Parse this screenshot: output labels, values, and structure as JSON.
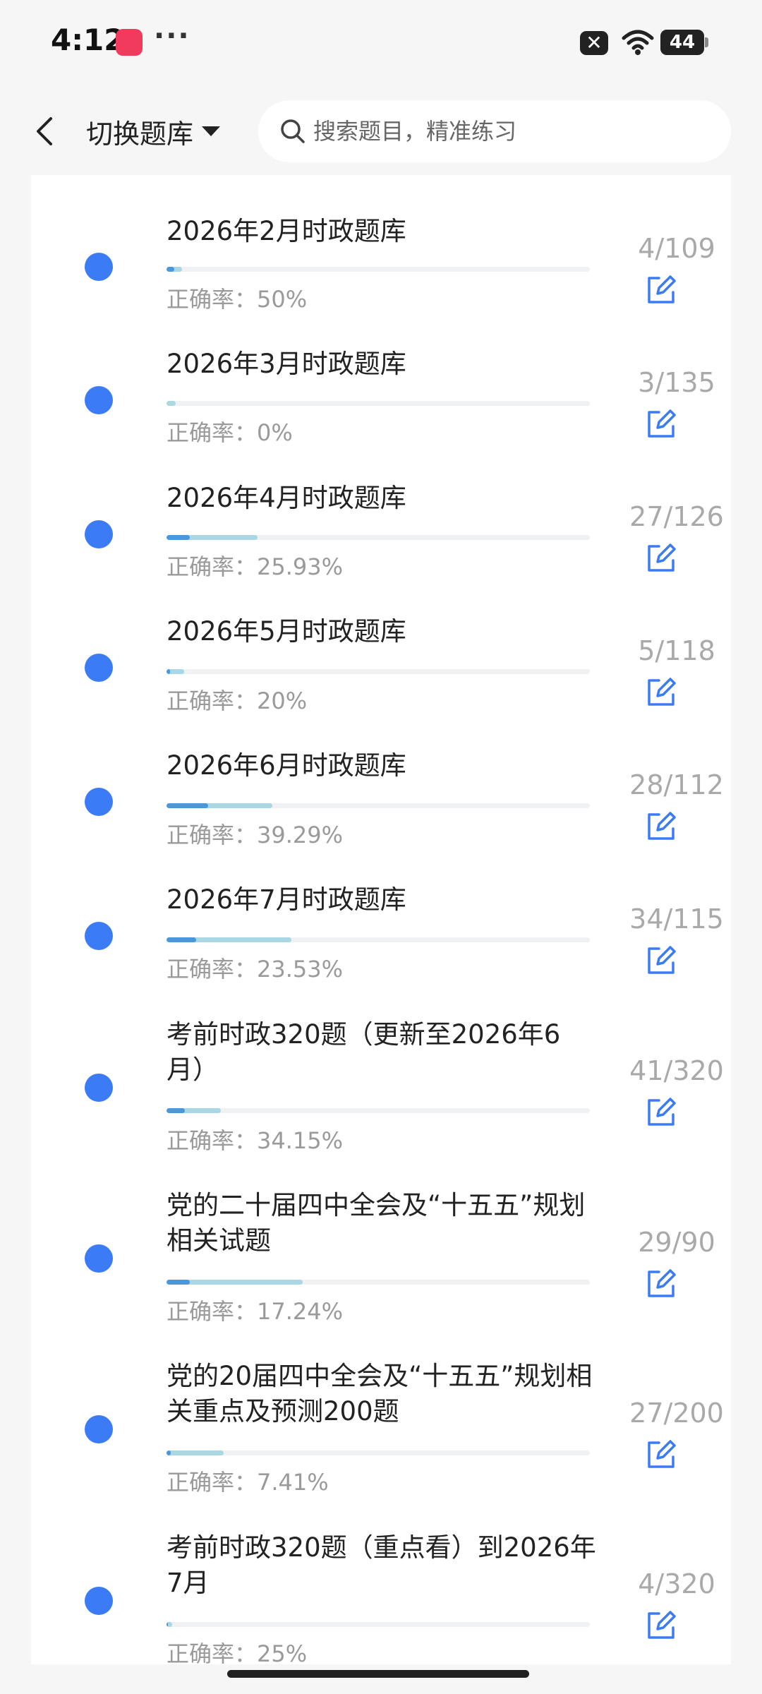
{
  "status_bar": {
    "time": "4:12",
    "more": "···",
    "battery": "44"
  },
  "header": {
    "bank_label": "切换题库",
    "search_placeholder": "搜索题目，精准练习"
  },
  "accuracy_prefix": "正确率：",
  "colors": {
    "accent": "#3b7bf6",
    "progress_correct": "#4b97dc",
    "progress_total": "#a9d8e4"
  },
  "items": [
    {
      "title": "2026年2月时政题库",
      "done": 4,
      "total": 109,
      "count": "4/109",
      "accuracy": "50%"
    },
    {
      "title": "2026年3月时政题库",
      "done": 3,
      "total": 135,
      "count": "3/135",
      "accuracy": "0%"
    },
    {
      "title": "2026年4月时政题库",
      "done": 27,
      "total": 126,
      "count": "27/126",
      "accuracy": "25.93%"
    },
    {
      "title": "2026年5月时政题库",
      "done": 5,
      "total": 118,
      "count": "5/118",
      "accuracy": "20%"
    },
    {
      "title": "2026年6月时政题库",
      "done": 28,
      "total": 112,
      "count": "28/112",
      "accuracy": "39.29%"
    },
    {
      "title": "2026年7月时政题库",
      "done": 34,
      "total": 115,
      "count": "34/115",
      "accuracy": "23.53%"
    },
    {
      "title": "考前时政320题（更新至2026年6月）",
      "done": 41,
      "total": 320,
      "count": "41/320",
      "accuracy": "34.15%"
    },
    {
      "title": "党的二十届四中全会及“十五五”规划相关试题",
      "done": 29,
      "total": 90,
      "count": "29/90",
      "accuracy": "17.24%"
    },
    {
      "title": "党的20届四中全会及“十五五”规划相关重点及预测200题",
      "done": 27,
      "total": 200,
      "count": "27/200",
      "accuracy": "7.41%"
    },
    {
      "title": "考前时政320题（重点看）到2026年7月",
      "done": 4,
      "total": 320,
      "count": "4/320",
      "accuracy": "25%"
    }
  ]
}
